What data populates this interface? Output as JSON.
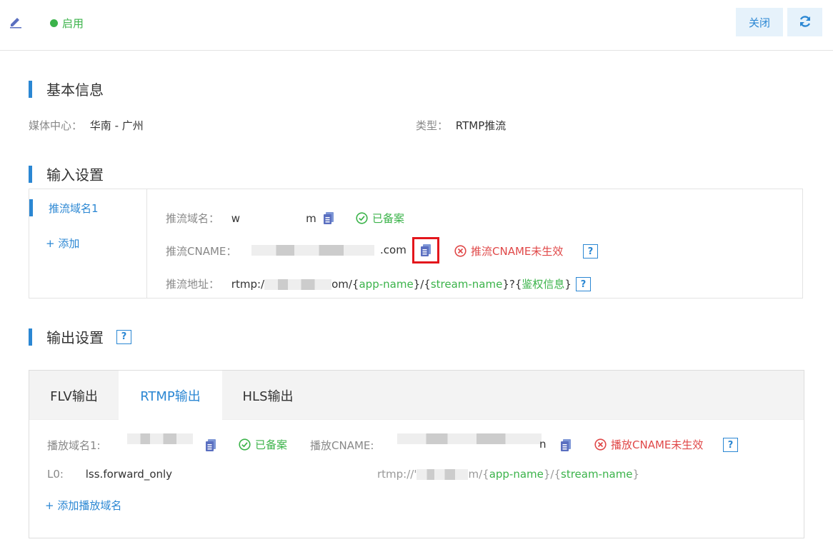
{
  "header": {
    "status": "启用",
    "close_label": "关闭"
  },
  "basic": {
    "title": "基本信息",
    "media_center_label": "媒体中心：",
    "media_center_value": "华南 - 广州",
    "type_label": "类型：",
    "type_value": "RTMP推流"
  },
  "input": {
    "title": "输入设置",
    "domain_tab": "推流域名1",
    "add_label": "+ 添加",
    "push_domain_label": "推流域名：",
    "push_domain_prefix": "w",
    "push_domain_suffix": "m",
    "push_domain_status": "已备案",
    "cname_label": "推流CNAME：",
    "cname_suffix": ".com",
    "cname_status": "推流CNAME未生效",
    "address_label": "推流地址：",
    "address_prefix": "rtmp:/",
    "address_mid": "om/{",
    "address_app": "app-name",
    "address_sep": "}/{",
    "address_stream": "stream-name",
    "address_q": "}?{",
    "address_auth": "鉴权信息",
    "address_end": "}"
  },
  "output": {
    "title": "输出设置",
    "tabs": [
      "FLV输出",
      "RTMP输出",
      "HLS输出"
    ],
    "play_domain_label": "播放域名1:",
    "play_domain_status": "已备案",
    "play_cname_label": "播放CNAME:",
    "play_cname_suffix": "n",
    "play_cname_status": "播放CNAME未生效",
    "l0_label": "L0:",
    "l0_value": "lss.forward_only",
    "l0_url_prefix": "rtmp://'",
    "l0_url_mid": "m/{",
    "l0_url_app": "app-name",
    "l0_url_sep": "}/{",
    "l0_url_stream": "stream-name",
    "l0_url_end": "}",
    "add_play_domain": "+ 添加播放域名"
  },
  "help_glyph": "?",
  "colors": {
    "accent": "#2b87d3",
    "success": "#3bb34a",
    "error": "#e04848",
    "highlight": "#e3161c"
  }
}
